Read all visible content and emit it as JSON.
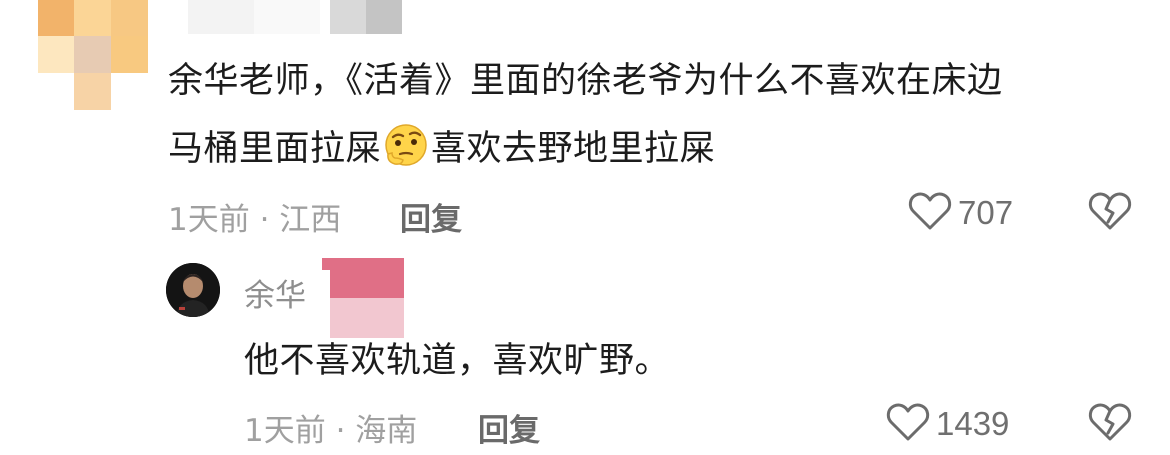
{
  "comment": {
    "text_line1": "余华老师，《活着》里面的徐老爷为什么不喜欢在床边",
    "text_line2_before_emoji": "马桶里面拉屎",
    "emoji": "thinking-face-icon",
    "text_line2_after_emoji": "喜欢去野地里拉屎",
    "time_location": "1天前 · 江西",
    "reply_label": "回复",
    "likes": "707"
  },
  "reply": {
    "author": "余华",
    "text": "他不喜欢轨道，喜欢旷野。",
    "time_location": "1天前 · 海南",
    "reply_label": "回复",
    "likes": "1439"
  },
  "colors": {
    "mosaic_orange": "#f7c27a",
    "mosaic_pink": "#e5738a",
    "mosaic_gray": "#c8c8c8"
  }
}
